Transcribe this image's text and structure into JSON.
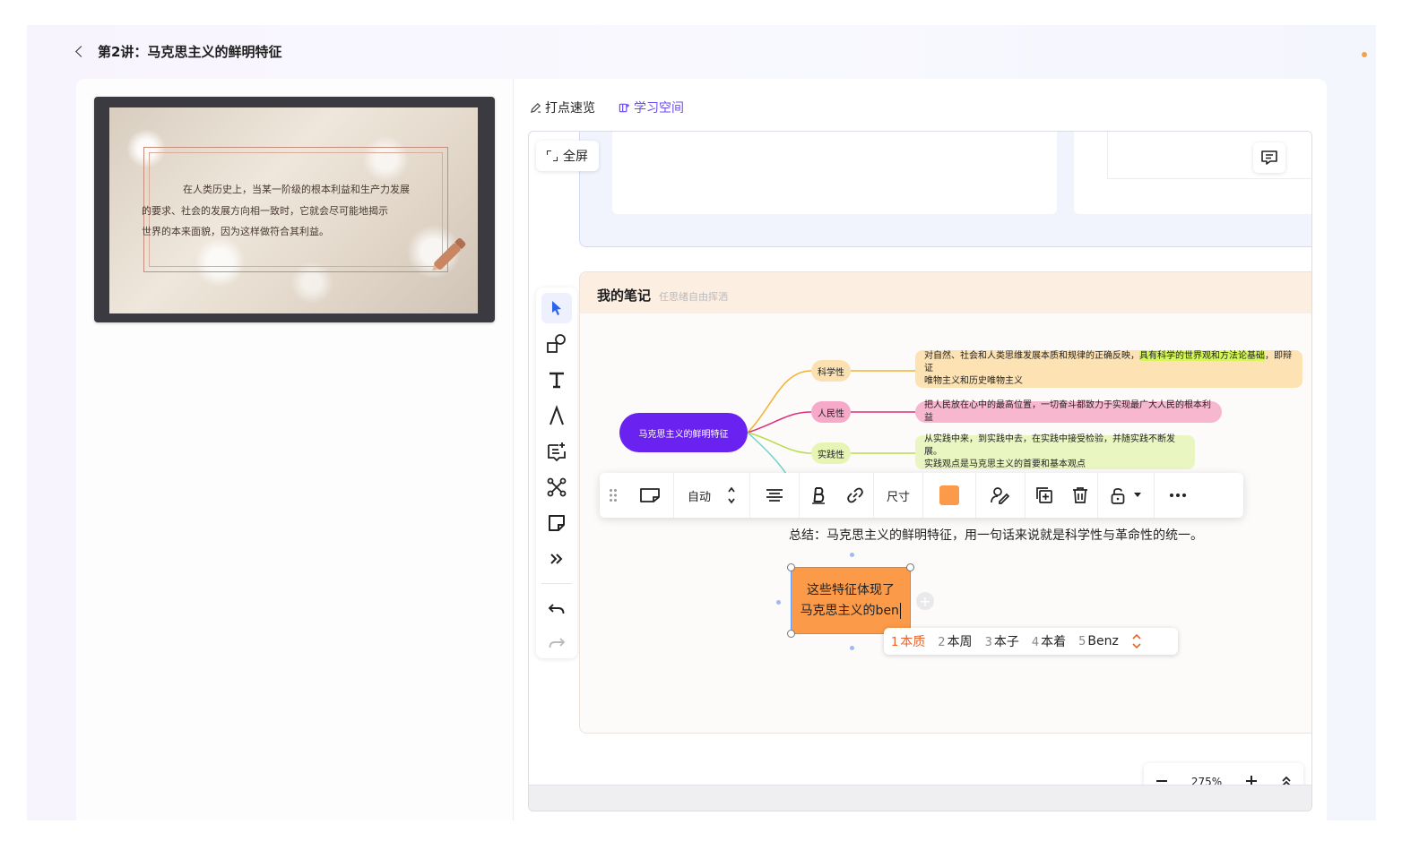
{
  "header": {
    "title": "第2讲：马克思主义的鲜明特征"
  },
  "video": {
    "slide_lines": [
      "在人类历史上，当某一阶级的根本利益和生产力发展",
      "的要求、社会的发展方向相一致时，它就会尽可能地揭示",
      "世界的本来面貌，因为这样做符合其利益。"
    ]
  },
  "tabs": [
    {
      "label": "打点速览",
      "icon": "edit-pen-icon"
    },
    {
      "label": "学习空间",
      "icon": "book-space-icon",
      "active": true
    }
  ],
  "board": {
    "fullscreen_label": "全屏",
    "notes_title": "我的笔记",
    "notes_subtitle": "任思绪自由挥洒"
  },
  "mindmap": {
    "root": "马克思主义的鲜明特征",
    "branches": [
      {
        "label": "科学性",
        "color": "#f2b133",
        "fill": "#fbe1b2",
        "detail_parts": [
          "对自然、社会和人类思维发展本质和规律的正确反映，",
          "具有科学的世界观和方法论基础",
          "，即辩证"
        ],
        "detail_line2": "唯物主义和历史唯物主义",
        "detail_fill": "#fde2b4"
      },
      {
        "label": "人民性",
        "color": "#dc2d7b",
        "fill": "#f6a9c8",
        "detail": "把人民放在心中的最高位置，一切奋斗都致力于实现最广大人民的根本利益",
        "detail_fill": "#f7b7cf"
      },
      {
        "label": "实践性",
        "color": "#b8dc4a",
        "fill": "#e6f5b4",
        "detail": "从实践中来，到实践中去，在实践中接受检验，并随实践不断发展。",
        "detail_line2": "实践观点是马克思主义的首要和基本观点",
        "detail_fill": "#eaf6c2"
      }
    ]
  },
  "toolbar": {
    "auto_label": "自动",
    "size_label": "尺寸",
    "fill_color": "#fb9a48"
  },
  "summary": "总结：马克思主义的鲜明特征，用一句话来说就是科学性与革命性的统一。",
  "sticky": {
    "line1": "这些特征体现了",
    "line2": "马克思主义的ben",
    "color": "#fb9a48"
  },
  "ime": {
    "candidates": [
      {
        "num": "1",
        "text": "本质"
      },
      {
        "num": "2",
        "text": "本周"
      },
      {
        "num": "3",
        "text": "本子"
      },
      {
        "num": "4",
        "text": "本着"
      },
      {
        "num": "5",
        "text": "Benz"
      }
    ]
  },
  "zoom": {
    "level": "275%"
  }
}
